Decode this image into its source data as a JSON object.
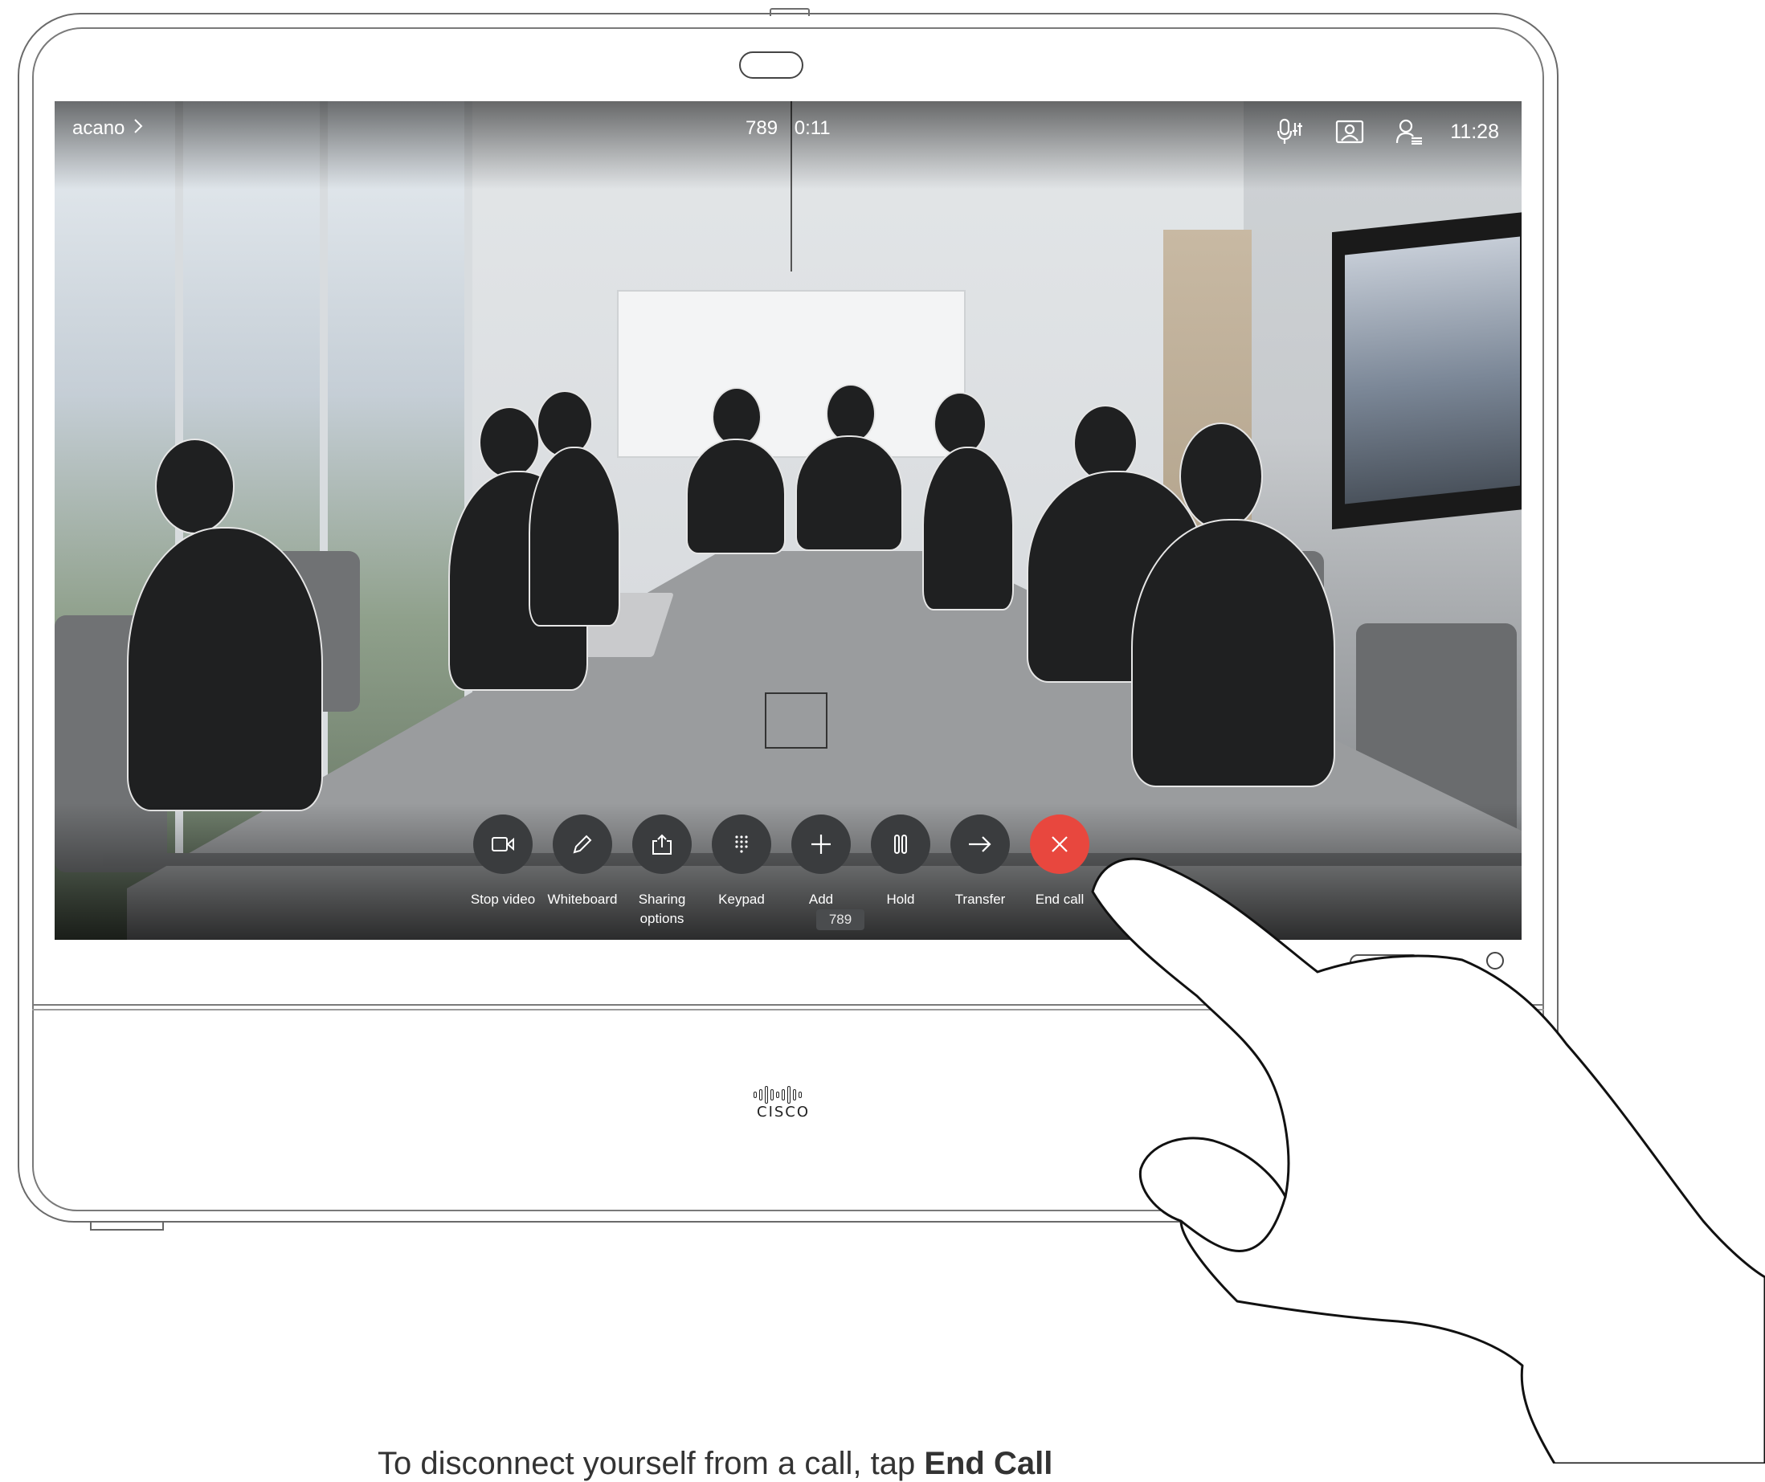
{
  "topbar": {
    "left_label": "acano",
    "left_chevron_icon": "chevron-right-icon",
    "call_number": "789",
    "call_duration": "0:11",
    "clock": "11:28",
    "icons": [
      "microphone-settings-icon",
      "self-view-icon",
      "participants-icon"
    ]
  },
  "controls": [
    {
      "label": "Stop video",
      "icon": "video-camera-icon"
    },
    {
      "label": "Whiteboard",
      "icon": "pencil-icon"
    },
    {
      "label": "Sharing\noptions",
      "icon": "share-icon"
    },
    {
      "label": "Keypad",
      "icon": "keypad-icon"
    },
    {
      "label": "Add",
      "icon": "plus-icon"
    },
    {
      "label": "Hold",
      "icon": "pause-icon"
    },
    {
      "label": "Transfer",
      "icon": "arrow-right-icon"
    },
    {
      "label": "End call",
      "icon": "close-icon",
      "color": "#e8473e"
    }
  ],
  "callee_badge": "789",
  "brand": "CISCO",
  "caption": {
    "text": "To disconnect yourself from a call, tap ",
    "bold": "End Call"
  }
}
